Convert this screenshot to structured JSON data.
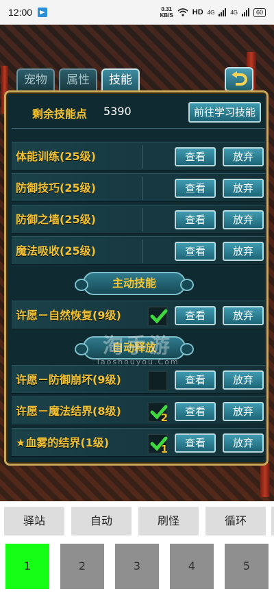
{
  "status_bar": {
    "time": "12:00",
    "net_speed_value": "0.31",
    "net_speed_unit": "KB/S",
    "hd_label": "HD",
    "signal_4g_1": "4G",
    "signal_4g_2": "4G",
    "battery": "60"
  },
  "tabs": [
    {
      "label": "宠物",
      "active": false
    },
    {
      "label": "属性",
      "active": false
    },
    {
      "label": "技能",
      "active": true
    }
  ],
  "panel": {
    "points_label": "剩余技能点",
    "points_value": "5390",
    "learn_button": "前往学习技能",
    "passive_skills": [
      {
        "name": "体能训练(25级)"
      },
      {
        "name": "防御技巧(25级)"
      },
      {
        "name": "防御之墙(25级)"
      },
      {
        "name": "魔法吸收(25级)"
      }
    ],
    "active_section_title": "主动技能",
    "active_skills": [
      {
        "name": "许愿－自然恢复(9级)",
        "checked": true,
        "badge": ""
      }
    ],
    "auto_section_title": "自动释放",
    "auto_skills": [
      {
        "name": "许愿－防御崩坏(9级)",
        "checked": false,
        "badge": ""
      },
      {
        "name": "许愿－魔法结界(8级)",
        "checked": true,
        "badge": "2"
      },
      {
        "name": "★血雾的结界(1级)",
        "checked": true,
        "badge": "1"
      }
    ],
    "view_label": "查看",
    "drop_label": "放弃"
  },
  "watermark": {
    "big": "淘手游",
    "small": "Taoshouyou.Com"
  },
  "bottom": {
    "commands": [
      "驿站",
      "自动",
      "刷怪",
      "循环"
    ],
    "slots": [
      {
        "label": "1",
        "active": true
      },
      {
        "label": "2",
        "active": false
      },
      {
        "label": "3",
        "active": false
      },
      {
        "label": "4",
        "active": false
      },
      {
        "label": "5",
        "active": false
      }
    ]
  },
  "colors": {
    "skill_text": "#f2c233",
    "panel_border": "#c9a85a",
    "button": "#1d6577",
    "active_slot": "#14ff14"
  }
}
